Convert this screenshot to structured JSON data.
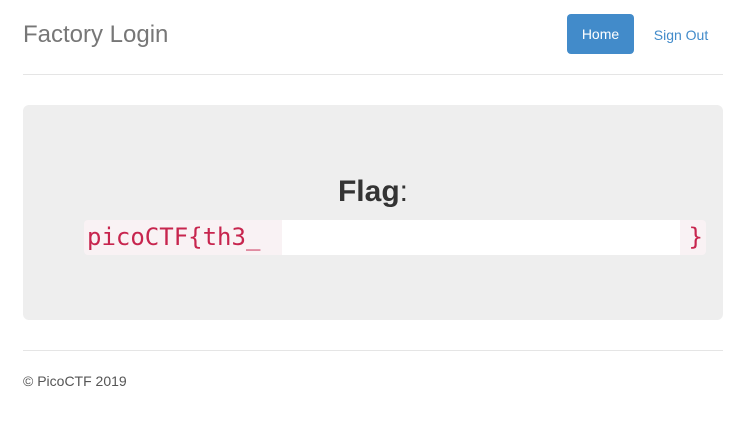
{
  "header": {
    "brand": "Factory Login",
    "nav": {
      "home_label": "Home",
      "signout_label": "Sign Out"
    }
  },
  "main": {
    "flag_label": "Flag",
    "flag_colon": ":",
    "flag_prefix": "picoCTF{th3_",
    "flag_suffix": "}"
  },
  "footer": {
    "copyright": "© PicoCTF 2019"
  },
  "colors": {
    "accent": "#428bca",
    "code_text": "#c7254e",
    "code_bg": "#f9f2f4",
    "jumbotron_bg": "#eeeeee"
  }
}
